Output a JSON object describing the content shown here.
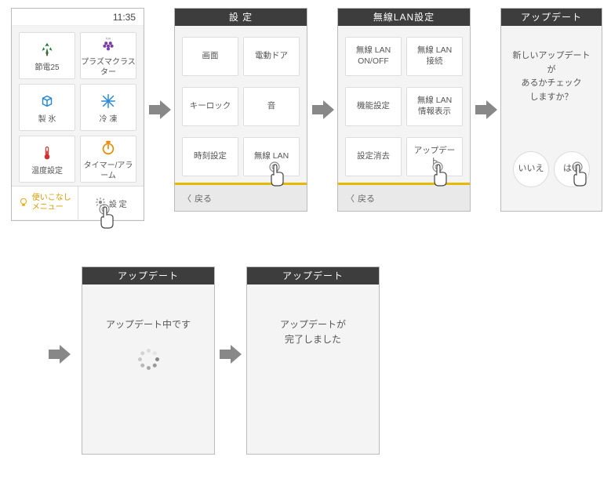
{
  "home": {
    "time": "11:35",
    "tiles": [
      {
        "label": "節電25",
        "icon": "leaf"
      },
      {
        "label": "プラズマクラスター",
        "icon": "grape"
      },
      {
        "label": "製 氷",
        "icon": "ice"
      },
      {
        "label": "冷 凍",
        "icon": "snow"
      },
      {
        "label": "温度設定",
        "icon": "thermo"
      },
      {
        "label": "タイマー/アラーム",
        "icon": "timer"
      }
    ],
    "footer": {
      "tips": "使いこなし\nメニュー",
      "settings": "設 定"
    }
  },
  "settings": {
    "title": "設 定",
    "items": [
      "画面",
      "電動ドア",
      "キーロック",
      "音",
      "時刻設定",
      "無線 LAN"
    ],
    "back": "戻る"
  },
  "wlan": {
    "title": "無線LAN設定",
    "items": [
      "無線 LAN\nON/OFF",
      "無線 LAN\n接続",
      "機能設定",
      "無線 LAN\n情報表示",
      "設定消去",
      "アップデート"
    ],
    "back": "戻る"
  },
  "update_confirm": {
    "title": "アップデート",
    "message": "新しいアップデートが\nあるかチェック\nしますか？",
    "no": "いいえ",
    "yes": "はい"
  },
  "update_running": {
    "title": "アップデート",
    "message": "アップデート中です"
  },
  "update_done": {
    "title": "アップデート",
    "message": "アップデートが\n完了しました"
  }
}
